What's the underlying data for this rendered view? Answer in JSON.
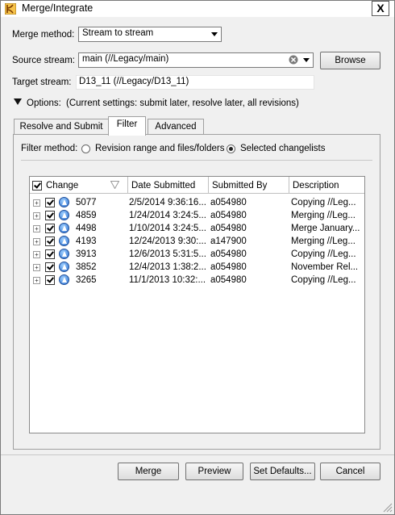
{
  "window": {
    "title": "Merge/Integrate",
    "close": "X"
  },
  "merge_method": {
    "label": "Merge method:",
    "value": "Stream to stream"
  },
  "source_stream": {
    "label": "Source stream:",
    "value": "main (//Legacy/main)",
    "browse": "Browse"
  },
  "target_stream": {
    "label": "Target stream:",
    "value": "D13_11 (//Legacy/D13_11)"
  },
  "options": {
    "label": "Options:",
    "summary": "(Current settings: submit later, resolve later, all revisions)"
  },
  "tabs": [
    {
      "label": "Resolve and Submit",
      "active": false
    },
    {
      "label": "Filter",
      "active": true
    },
    {
      "label": "Advanced",
      "active": false
    }
  ],
  "filter": {
    "label": "Filter method:",
    "options": [
      {
        "label": "Revision range and files/folders",
        "selected": false
      },
      {
        "label": "Selected changelists",
        "selected": true
      }
    ]
  },
  "table": {
    "columns": [
      "Change",
      "Date Submitted",
      "Submitted By",
      "Description"
    ],
    "rows": [
      {
        "change": "5077",
        "date": "2/5/2014 9:36:16...",
        "by": "a054980",
        "desc": "Copying //Leg..."
      },
      {
        "change": "4859",
        "date": "1/24/2014 3:24:5...",
        "by": "a054980",
        "desc": "Merging //Leg..."
      },
      {
        "change": "4498",
        "date": "1/10/2014 3:24:5...",
        "by": "a054980",
        "desc": "Merge January..."
      },
      {
        "change": "4193",
        "date": "12/24/2013 9:30:...",
        "by": "a147900",
        "desc": "Merging //Leg..."
      },
      {
        "change": "3913",
        "date": "12/6/2013 5:31:5...",
        "by": "a054980",
        "desc": "Copying //Leg..."
      },
      {
        "change": "3852",
        "date": "12/4/2013 1:38:2...",
        "by": "a054980",
        "desc": "November Rel..."
      },
      {
        "change": "3265",
        "date": "11/1/2013 10:32:...",
        "by": "a054980",
        "desc": "Copying //Leg..."
      }
    ]
  },
  "buttons": {
    "merge": "Merge",
    "preview": "Preview",
    "set_defaults": "Set Defaults...",
    "cancel": "Cancel"
  },
  "colors": {
    "accent": "#2b6fd0",
    "border": "#a0a0a0",
    "background": "#f0f0f0"
  }
}
